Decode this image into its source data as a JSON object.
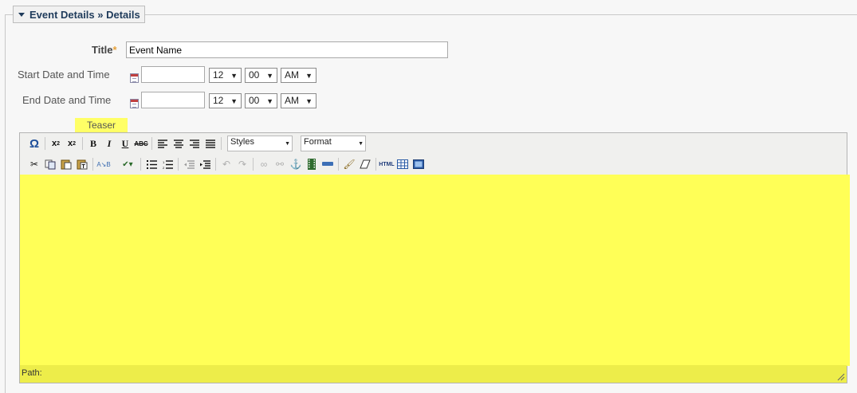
{
  "legend": {
    "label": "Event Details » Details"
  },
  "title_field": {
    "label": "Title",
    "required_mark": "*",
    "value": "Event Name"
  },
  "start": {
    "label": "Start Date and Time",
    "date_value": "",
    "hour": "12",
    "minute": "00",
    "ampm": "AM"
  },
  "end": {
    "label": "End Date and Time",
    "date_value": "",
    "hour": "12",
    "minute": "00",
    "ampm": "AM"
  },
  "teaser": {
    "label": "Teaser"
  },
  "editor": {
    "styles_label": "Styles",
    "format_label": "Format",
    "path_label": "Path:",
    "content_color": "#ffff57"
  }
}
